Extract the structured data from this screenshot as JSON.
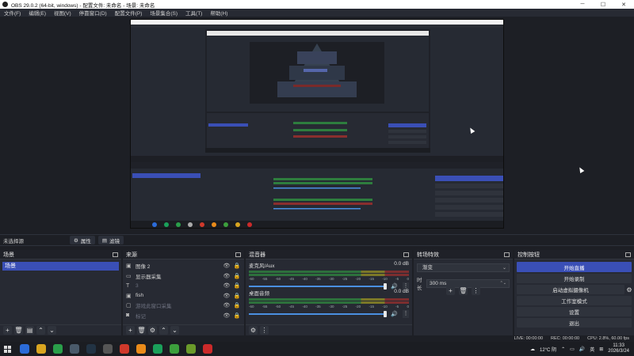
{
  "titlebar": {
    "title": "OBS 29.0.2 (64-bit, windows) - 配置文件: 未命名 - 场景: 未命名",
    "buttons": {
      "minimize": "─",
      "maximize": "☐",
      "close": "✕"
    }
  },
  "menubar": {
    "items": [
      "文件(F)",
      "编辑(E)",
      "视图(V)",
      "停靠窗口(D)",
      "配置文件(P)",
      "场景集合(S)",
      "工具(T)",
      "帮助(H)"
    ]
  },
  "selection_toolbar": {
    "no_source": "未选择源",
    "properties": "属性",
    "filters": "滤镜"
  },
  "scenes": {
    "title": "场景",
    "items": [
      "场景"
    ]
  },
  "sources": {
    "title": "来源",
    "items": [
      {
        "name": "图像 2",
        "icon": "image-icon",
        "dim": false
      },
      {
        "name": "显示器采集",
        "icon": "monitor-icon",
        "dim": false
      },
      {
        "name": "3",
        "icon": "text-icon",
        "dim": true
      },
      {
        "name": "fish",
        "icon": "image-icon",
        "dim": false
      },
      {
        "name": "游戏此窗口采集",
        "icon": "window-icon",
        "dim": true
      },
      {
        "name": "标记",
        "icon": "camera-icon",
        "dim": true
      }
    ]
  },
  "mixer": {
    "title": "混音器",
    "tracks": [
      {
        "name": "麦克风/Aux",
        "db": "0.0 dB"
      },
      {
        "name": "桌面音频",
        "db": "0.0 dB"
      }
    ],
    "ticks": [
      "-60",
      "-55",
      "-50",
      "-45",
      "-40",
      "-35",
      "-30",
      "-25",
      "-20",
      "-15",
      "-10",
      "-5",
      "0"
    ]
  },
  "transitions": {
    "title": "转场特效",
    "selected": "渐变",
    "duration_label": "时长",
    "duration_value": "300 ms"
  },
  "controls": {
    "title": "控制按钮",
    "start_streaming": "开始直播",
    "start_recording": "开始录制",
    "virtual_camera": "启动虚拟摄像机",
    "studio_mode": "工作室模式",
    "settings": "设置",
    "exit": "退出"
  },
  "statusbar": {
    "live": "LIVE: 00:00:00",
    "rec": "REC: 00:00:00",
    "cpu": "CPU: 2.8%, 60.00 fps"
  },
  "taskbar": {
    "weather": "12°C 阴",
    "ime": "英",
    "time": "11:33",
    "date": "2026/3/24",
    "apps": [
      "#2b6bd8",
      "#1aa05a",
      "#2a9f4a",
      "#4a5a6a",
      "#223344",
      "#555555",
      "#d0392b",
      "#ea8b1a",
      "#3c9f3c",
      "#d9a520",
      "#6a9a2a",
      "#cc2a2a"
    ]
  },
  "colors": {
    "accent": "#3a4fb6",
    "panel": "#272a33",
    "background": "#1d1f25"
  }
}
